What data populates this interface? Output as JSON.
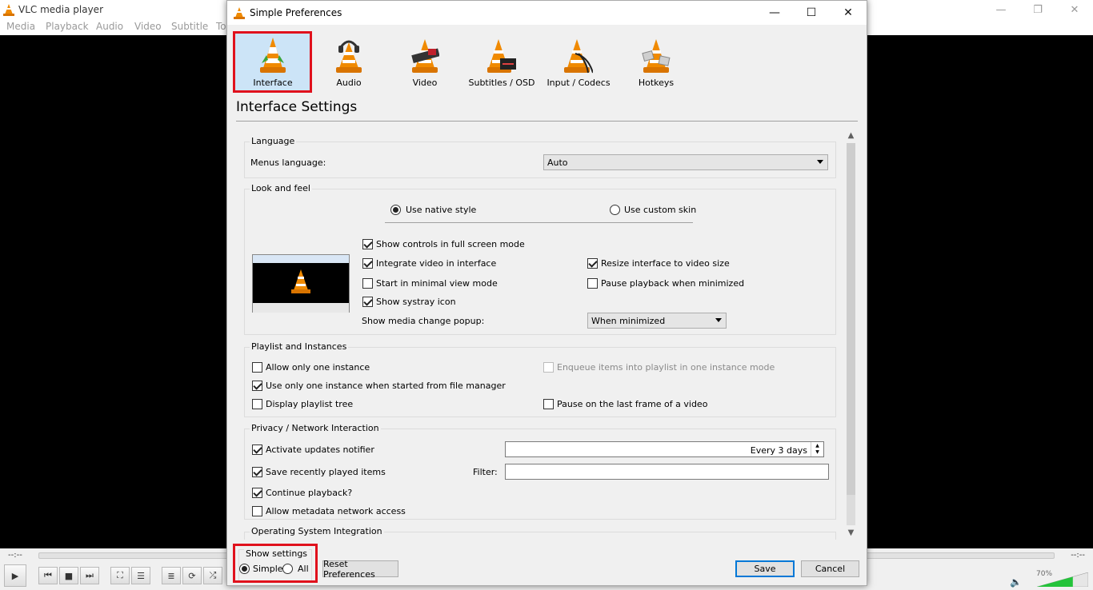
{
  "vlc": {
    "title": "VLC media player",
    "menu": [
      "Media",
      "Playback",
      "Audio",
      "Video",
      "Subtitle",
      "To"
    ],
    "time_elapsed": "--:--",
    "time_total": "--:--",
    "volume_pct": "70%",
    "volume_level": 0.7
  },
  "dialog": {
    "title": "Simple Preferences",
    "categories": [
      {
        "label": "Interface",
        "icon": "interface-cone-icon"
      },
      {
        "label": "Audio",
        "icon": "headphones-cone-icon"
      },
      {
        "label": "Video",
        "icon": "film-cone-icon"
      },
      {
        "label": "Subtitles / OSD",
        "icon": "subtitles-cone-icon"
      },
      {
        "label": "Input / Codecs",
        "icon": "codecs-cone-icon"
      },
      {
        "label": "Hotkeys",
        "icon": "hotkeys-cone-icon"
      }
    ],
    "selected_category": "Interface",
    "page_title": "Interface Settings"
  },
  "language": {
    "group": "Language",
    "menus_label": "Menus language:",
    "menus_value": "Auto"
  },
  "look": {
    "group": "Look and feel",
    "native": "Use native style",
    "custom": "Use custom skin",
    "fullscreen_controls": "Show controls in full screen mode",
    "integrate_video": "Integrate video in interface",
    "resize_interface": "Resize interface to video size",
    "minimal_view": "Start in minimal view mode",
    "pause_minimized": "Pause playback when minimized",
    "systray": "Show systray icon",
    "popup_label": "Show media change popup:",
    "popup_value": "When minimized"
  },
  "playlist": {
    "group": "Playlist and Instances",
    "one_instance": "Allow only one instance",
    "enqueue": "Enqueue items into playlist in one instance mode",
    "file_manager": "Use only one instance when started from file manager",
    "playlist_tree": "Display playlist tree",
    "last_frame": "Pause on the last frame of a video"
  },
  "privacy": {
    "group": "Privacy / Network Interaction",
    "updates": "Activate updates notifier",
    "updates_value": "Every 3 days",
    "recent": "Save recently played items",
    "filter_label": "Filter:",
    "filter_value": "",
    "continue": "Continue playback?",
    "metadata": "Allow metadata network access"
  },
  "os": {
    "group": "Operating System Integration"
  },
  "footer": {
    "show_settings": "Show settings",
    "simple": "Simple",
    "all": "All",
    "reset": "Reset Preferences",
    "save": "Save",
    "cancel": "Cancel"
  }
}
